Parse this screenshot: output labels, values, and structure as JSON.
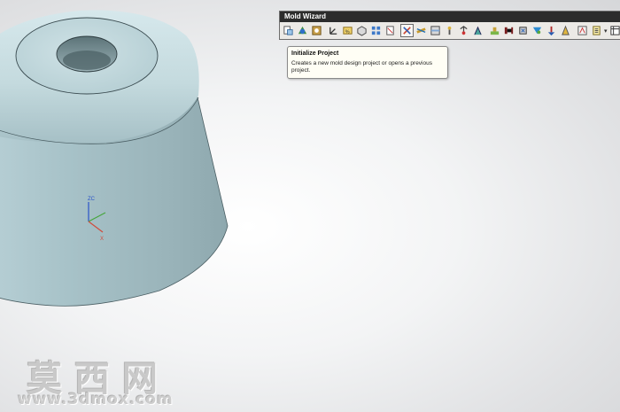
{
  "toolbar": {
    "title": "Mold Wizard",
    "icons": [
      "project-create-icon",
      "initialize-project-icon",
      "family-mold-icon",
      "mold-csys-icon",
      "shrinkage-icon",
      "workpiece-icon",
      "layout-icon",
      "multi-body-icon",
      "mold-tools-icon",
      "parting-icon",
      "moldbase-icon",
      "standard-part-icon",
      "ejector-pin-icon",
      "ejector-trim-icon",
      "slider-lifter-icon",
      "sub-insert-icon",
      "gate-icon",
      "runner-icon",
      "cooling-icon",
      "electrode-icon",
      "trim-tools-icon",
      "pocket-icon",
      "bom-icon",
      "drawing-icon",
      "view-manager-icon"
    ],
    "pressed_icon": "mold-tools-icon"
  },
  "tooltip": {
    "title": "Initialize Project",
    "description": "Creates a new mold design project or opens a previous project."
  },
  "watermark": {
    "chinese": "莫西网",
    "url": "www.3dmox.com"
  },
  "colors": {
    "part_body": "#a9c3c9",
    "part_highlight": "#d8eaee",
    "background": "#e6e7e8",
    "toolbar_bg": "#eceae6",
    "tooltip_bg": "#fffef5"
  }
}
